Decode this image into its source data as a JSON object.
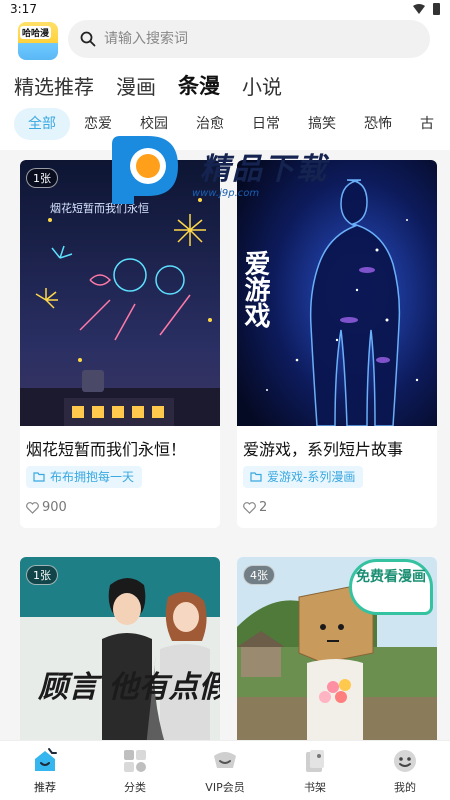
{
  "status_bar": {
    "time": "3:17"
  },
  "app_logo_text": "哈哈漫",
  "search": {
    "placeholder": "请输入搜索词"
  },
  "main_tabs": [
    {
      "label": "精选推荐",
      "active": false
    },
    {
      "label": "漫画",
      "active": false
    },
    {
      "label": "条漫",
      "active": true
    },
    {
      "label": "小说",
      "active": false
    }
  ],
  "genres": [
    {
      "label": "全部",
      "active": true
    },
    {
      "label": "恋爱",
      "active": false
    },
    {
      "label": "校园",
      "active": false
    },
    {
      "label": "治愈",
      "active": false
    },
    {
      "label": "日常",
      "active": false
    },
    {
      "label": "搞笑",
      "active": false
    },
    {
      "label": "恐怖",
      "active": false
    },
    {
      "label": "古",
      "active": false
    }
  ],
  "cards": [
    {
      "badge": "1张",
      "title": "烟花短暂而我们永恒！",
      "tag": "布布拥抱每一天",
      "likes": "900",
      "cover_text": "烟花短暂而我们永恒"
    },
    {
      "badge": "",
      "title": "爱游戏，系列短片故事",
      "tag": "爱游戏-系列漫画",
      "likes": "2",
      "cover_text": "爱游戏"
    },
    {
      "badge": "1张",
      "cover_text": "顾言 他有点假正经"
    },
    {
      "badge": "4张",
      "free_badge": "免费看漫画"
    }
  ],
  "watermark": {
    "text": "精品下载",
    "url": "www.j9p.com"
  },
  "bottom_nav": [
    {
      "label": "推荐",
      "icon": "home-icon",
      "active": true
    },
    {
      "label": "分类",
      "icon": "category-icon",
      "active": false
    },
    {
      "label": "VIP会员",
      "icon": "vip-icon",
      "active": false
    },
    {
      "label": "书架",
      "icon": "bookshelf-icon",
      "active": false
    },
    {
      "label": "我的",
      "icon": "profile-icon",
      "active": false
    }
  ],
  "colors": {
    "accent": "#3aa8e0",
    "accent_bg": "#e4f4fd",
    "tab_highlight": "#7ed3ff",
    "free_badge": "#35c2a0"
  }
}
